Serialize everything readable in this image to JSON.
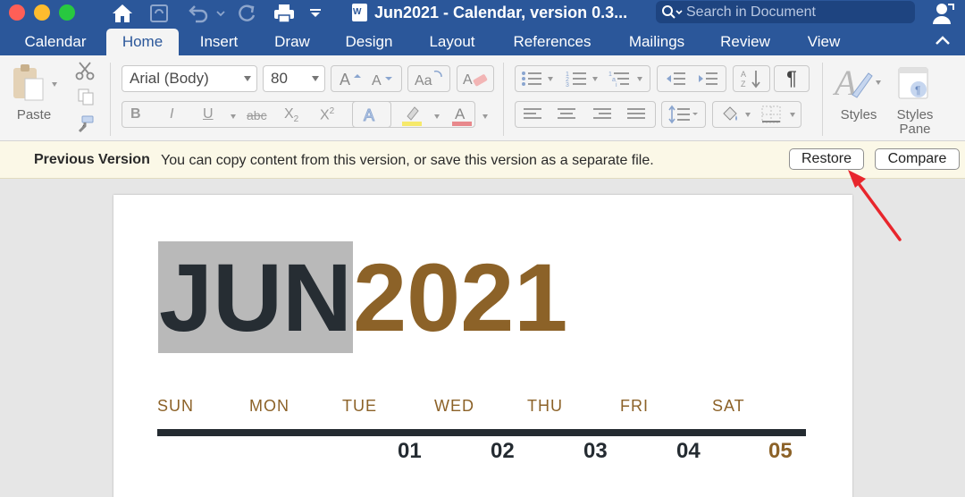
{
  "window": {
    "title": "Jun2021 - Calendar, version 0.3...",
    "search_placeholder": "Search in Document"
  },
  "tabs": [
    {
      "label": "Calendar",
      "active": false
    },
    {
      "label": "Home",
      "active": true
    },
    {
      "label": "Insert",
      "active": false
    },
    {
      "label": "Draw",
      "active": false
    },
    {
      "label": "Design",
      "active": false
    },
    {
      "label": "Layout",
      "active": false
    },
    {
      "label": "References",
      "active": false
    },
    {
      "label": "Mailings",
      "active": false
    },
    {
      "label": "Review",
      "active": false
    },
    {
      "label": "View",
      "active": false
    }
  ],
  "ribbon": {
    "paste_label": "Paste",
    "font_name": "Arial (Body)",
    "font_size": "80",
    "bold": "B",
    "italic": "I",
    "underline": "U",
    "strikethrough": "abc",
    "subscript": "X2",
    "superscript": "X2",
    "pilcrow": "¶",
    "styles_label": "Styles",
    "styles_pane_label_1": "Styles",
    "styles_pane_label_2": "Pane",
    "icons": [
      "cut-icon",
      "copy-icon",
      "format-painter-icon",
      "grow-font-icon",
      "shrink-font-icon",
      "change-case-icon",
      "clear-formatting-icon",
      "bullets-icon",
      "numbering-icon",
      "multilevel-list-icon",
      "decrease-indent-icon",
      "increase-indent-icon",
      "sort-icon",
      "align-left-icon",
      "align-center-icon",
      "align-right-icon",
      "justify-icon",
      "line-spacing-icon",
      "shading-icon",
      "borders-icon",
      "styles-icon",
      "styles-pane-icon"
    ]
  },
  "infobar": {
    "title": "Previous Version",
    "message": "You can copy content from this version, or save this version as a separate file.",
    "restore_label": "Restore",
    "compare_label": "Compare"
  },
  "document": {
    "month": "JUN",
    "year": "2021",
    "days": [
      "SUN",
      "MON",
      "TUE",
      "WED",
      "THU",
      "FRI",
      "SAT"
    ],
    "dates": [
      "01",
      "02",
      "03",
      "04",
      "05"
    ]
  },
  "colors": {
    "word_blue": "#2b579a",
    "accent_brown": "#8c6228",
    "dark_text": "#262d33",
    "annotation_red": "#e8262c"
  }
}
